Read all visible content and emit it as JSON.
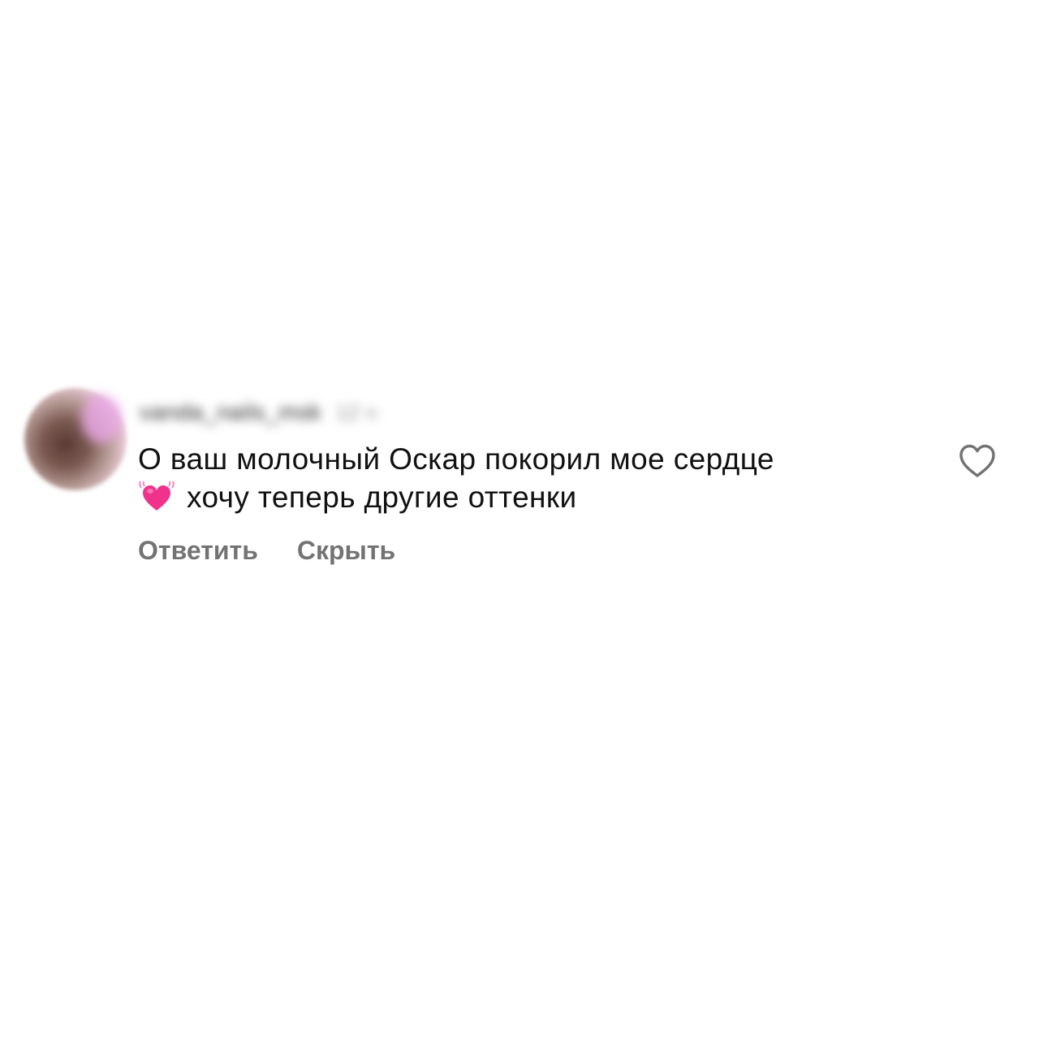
{
  "comment": {
    "username": "vanda_nails_msk",
    "time": "12 ч",
    "text_line1": "О ваш молочный Оскар покорил мое сердце",
    "emoji": "beating-heart-icon",
    "text_line2": "хочу теперь другие оттенки",
    "avatar_icon": "avatar",
    "like_icon": "heart-outline-icon"
  },
  "actions": {
    "reply_label": "Ответить",
    "hide_label": "Скрыть"
  },
  "colors": {
    "text": "#111111",
    "secondary": "#737373",
    "emoji_pink": "#f0328c"
  }
}
